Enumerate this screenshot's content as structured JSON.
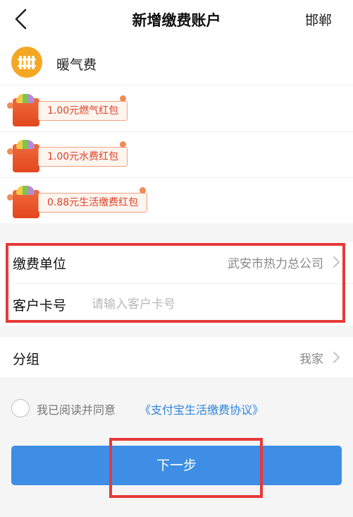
{
  "header": {
    "title": "新增缴费账户",
    "city": "邯郸"
  },
  "service": {
    "name": "暖气费",
    "icon": "radiator-icon",
    "icon_bg": "#f4a724"
  },
  "coupons": [
    {
      "label": "1.00元燃气红包"
    },
    {
      "label": "1.00元水费红包"
    },
    {
      "label": "0.88元生活缴费红包"
    }
  ],
  "form": {
    "unit_label": "缴费单位",
    "unit_value": "武安市热力总公司",
    "card_label": "客户卡号",
    "card_placeholder": "请输入客户卡号",
    "card_value": ""
  },
  "group": {
    "label": "分组",
    "value": "我家"
  },
  "agreement": {
    "text": "我已阅读并同意",
    "link": "《支付宝生活缴费协议》"
  },
  "next_button": {
    "label": "下一步"
  },
  "colors": {
    "accent": "#3d8ee4",
    "highlight": "#e63a3a",
    "coupon": "#d9432a"
  }
}
